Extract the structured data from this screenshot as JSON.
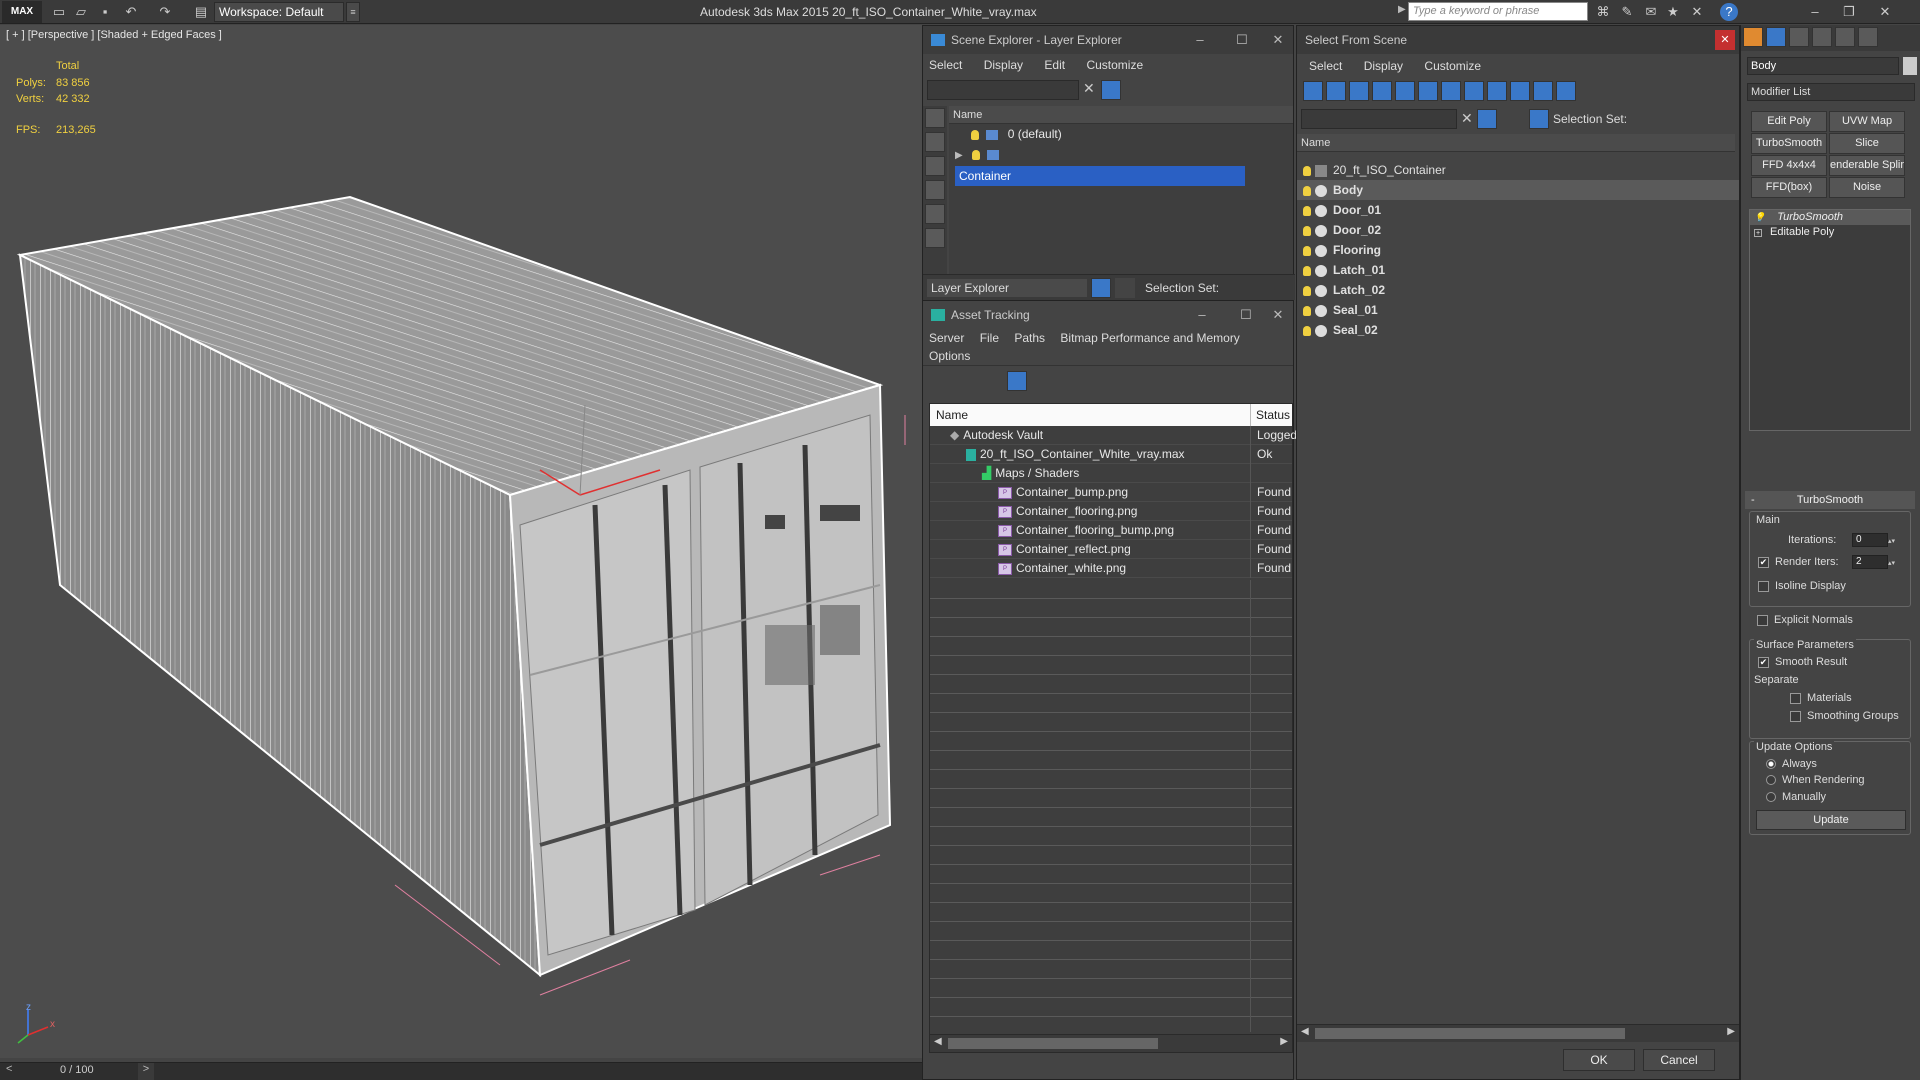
{
  "app": {
    "title": "Autodesk 3ds Max  2015    20_ft_ISO_Container_White_vray.max",
    "logo": "MAX",
    "workspace": "Workspace: Default",
    "search_placeholder": "Type a keyword or phrase",
    "window_controls": [
      "–",
      "❐",
      "✕"
    ]
  },
  "viewport": {
    "label": "[ + ] [Perspective ] [Shaded + Edged Faces ]",
    "stats": {
      "total_label": "Total",
      "polys_label": "Polys:",
      "polys_value": "83 856",
      "verts_label": "Verts:",
      "verts_value": "42 332",
      "fps_label": "FPS:",
      "fps_value": "213,265"
    },
    "axis": {
      "z": "z",
      "x": "x",
      "y": "y"
    }
  },
  "timeline": {
    "frame": "0 / 100",
    "prev": "<",
    "next": ">"
  },
  "layer_explorer": {
    "title": "Scene Explorer - Layer Explorer",
    "menu": [
      "Select",
      "Display",
      "Edit",
      "Customize"
    ],
    "column_name": "Name",
    "layers": [
      {
        "name": "0 (default)",
        "selected": false
      },
      {
        "name": "Container",
        "selected": true
      }
    ],
    "footer_dropdown": "Layer Explorer",
    "selection_set_label": "Selection Set:"
  },
  "asset_tracking": {
    "title": "Asset Tracking",
    "menu1": [
      "Server",
      "File",
      "Paths",
      "Bitmap Performance and Memory"
    ],
    "menu2": [
      "Options"
    ],
    "col_name": "Name",
    "col_status": "Status",
    "rows": [
      {
        "name": "Autodesk Vault",
        "status": "Logged",
        "indent": 1,
        "icon": "vault"
      },
      {
        "name": "20_ft_ISO_Container_White_vray.max",
        "status": "Ok",
        "indent": 2,
        "icon": "max"
      },
      {
        "name": "Maps / Shaders",
        "status": "",
        "indent": 3,
        "icon": "maps"
      },
      {
        "name": "Container_bump.png",
        "status": "Found",
        "indent": 4,
        "icon": "png"
      },
      {
        "name": "Container_flooring.png",
        "status": "Found",
        "indent": 4,
        "icon": "png"
      },
      {
        "name": "Container_flooring_bump.png",
        "status": "Found",
        "indent": 4,
        "icon": "png"
      },
      {
        "name": "Container_reflect.png",
        "status": "Found",
        "indent": 4,
        "icon": "png"
      },
      {
        "name": "Container_white.png",
        "status": "Found",
        "indent": 4,
        "icon": "png"
      }
    ]
  },
  "select_from_scene": {
    "title": "Select From Scene",
    "menu": [
      "Select",
      "Display",
      "Customize"
    ],
    "selection_set_label": "Selection Set:",
    "column_name": "Name",
    "objects": [
      {
        "name": "20_ft_ISO_Container",
        "bold": false,
        "highlight": false,
        "group": true
      },
      {
        "name": "Body",
        "bold": true,
        "highlight": true,
        "group": false
      },
      {
        "name": "Door_01",
        "bold": true,
        "highlight": false,
        "group": false
      },
      {
        "name": "Door_02",
        "bold": true,
        "highlight": false,
        "group": false
      },
      {
        "name": "Flooring",
        "bold": true,
        "highlight": false,
        "group": false
      },
      {
        "name": "Latch_01",
        "bold": true,
        "highlight": false,
        "group": false
      },
      {
        "name": "Latch_02",
        "bold": true,
        "highlight": false,
        "group": false
      },
      {
        "name": "Seal_01",
        "bold": true,
        "highlight": false,
        "group": false
      },
      {
        "name": "Seal_02",
        "bold": true,
        "highlight": false,
        "group": false
      }
    ],
    "ok": "OK",
    "cancel": "Cancel"
  },
  "modify_panel": {
    "object_name": "Body",
    "modifier_list": "Modifier List",
    "buttons": [
      "Edit Poly",
      "UVW Map",
      "TurboSmooth",
      "Slice",
      "FFD 4x4x4",
      "enderable Splir",
      "FFD(box)",
      "Noise"
    ],
    "stack": [
      "TurboSmooth",
      "Editable Poly"
    ],
    "rollout_title": "TurboSmooth",
    "main_label": "Main",
    "iterations_label": "Iterations:",
    "iterations_value": "0",
    "render_iters_label": "Render Iters:",
    "render_iters_value": "2",
    "isoline_label": "Isoline Display",
    "explicit_normals_label": "Explicit Normals",
    "surface_params_label": "Surface Parameters",
    "smooth_result_label": "Smooth Result",
    "separate_label": "Separate",
    "materials_label": "Materials",
    "smoothing_groups_label": "Smoothing Groups",
    "update_options_label": "Update Options",
    "always_label": "Always",
    "when_rendering_label": "When Rendering",
    "manually_label": "Manually",
    "update_button": "Update"
  }
}
